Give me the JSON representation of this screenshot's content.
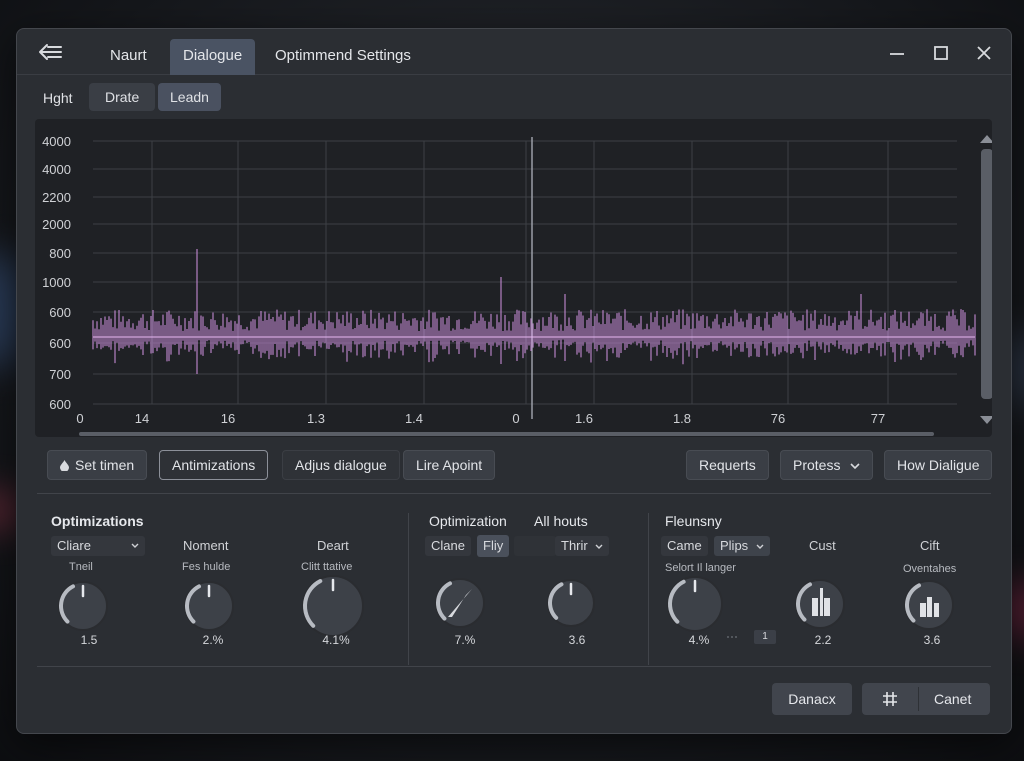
{
  "titlebar": {
    "tabs": [
      "Naurt",
      "Dialogue",
      "Optimmend Settings"
    ],
    "active_tab": 1
  },
  "subtabs": [
    "Hght",
    "Drate",
    "Leadn"
  ],
  "plot": {
    "y_ticks": [
      "4000",
      "4000",
      "2200",
      "2000",
      "800",
      "1000",
      "600",
      "600",
      "700",
      "600"
    ],
    "x_ticks": [
      "0",
      "14",
      "16",
      "1.3",
      "1.4",
      "0",
      "1.6",
      "1.8",
      "76",
      "77"
    ],
    "line_color": "#c58bd6"
  },
  "toolbar": {
    "set_timer": "Set timen",
    "antimizations": "Antimizations",
    "adjust_dialogue": "Adjus dialogue",
    "lire_apoint": "Lire Apoint",
    "requests": "Requerts",
    "protess": "Protess",
    "how_dialogue": "How Dialigue"
  },
  "panel1": {
    "title": "Optimizations",
    "select": "Cliare",
    "noment": "Noment",
    "deart": "Deart",
    "knobs": [
      {
        "label": "Tneil",
        "value": "1.5",
        "level": 0.45
      },
      {
        "label": "Fes hulde",
        "value": "2.%",
        "level": 0.5
      },
      {
        "label": "Clitt ttative",
        "value": "4.1%",
        "level": 0.85
      }
    ]
  },
  "panel2": {
    "title": "Optimization",
    "title2": "All houts",
    "chip1": "Clane",
    "chip2": "Fliy",
    "select": "Thrir",
    "knobs": [
      {
        "value": "7.%"
      },
      {
        "value": "3.6"
      }
    ]
  },
  "panel3": {
    "title": "Fleunsny",
    "chip1": "Came",
    "select": "Plips",
    "cust": "Cust",
    "cift": "Cift",
    "sub_label": "Selort Il langer",
    "sub_label2": "Oventahes",
    "mini_value": "1",
    "knobs": [
      {
        "value": "4.%"
      },
      {
        "value": "2.2"
      },
      {
        "value": "3.6"
      }
    ]
  },
  "footer": {
    "danacx": "Danacx",
    "canet": "Canet"
  }
}
